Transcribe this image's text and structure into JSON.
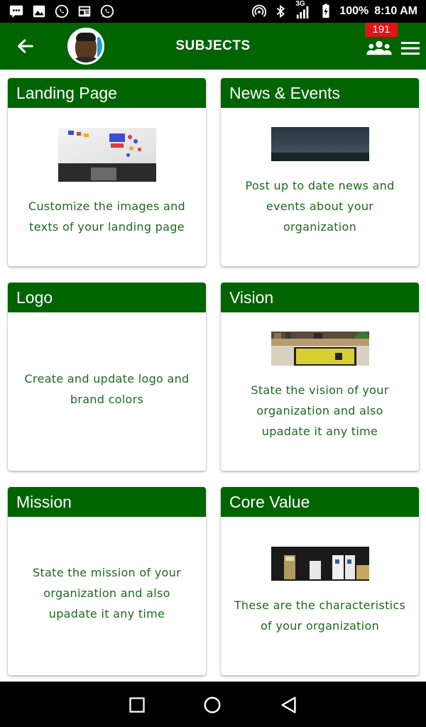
{
  "status_bar": {
    "network": "3G",
    "battery": "100%",
    "time": "8:10 AM"
  },
  "app_bar": {
    "title": "SUBJECTS",
    "notification_count": "191",
    "background": "#006400"
  },
  "cards": [
    {
      "title": "Landing Page",
      "description": "Customize the images and texts of your landing page",
      "has_image": true
    },
    {
      "title": "News & Events",
      "description": "Post up to date news and events about your organization",
      "has_image": true
    },
    {
      "title": "Logo",
      "description": "Create and update logo and brand colors",
      "has_image": false
    },
    {
      "title": "Vision",
      "description": "State the vision of your organization and also upadate it any time",
      "has_image": true
    },
    {
      "title": "Mission",
      "description": "State the mission of your organization and also upadate it any time",
      "has_image": false
    },
    {
      "title": "Core Value",
      "description": "These are the characteristics of your organization",
      "has_image": true
    }
  ],
  "colors": {
    "accent": "#006400",
    "description_text": "#1c6b1c",
    "badge": "#e01414"
  }
}
